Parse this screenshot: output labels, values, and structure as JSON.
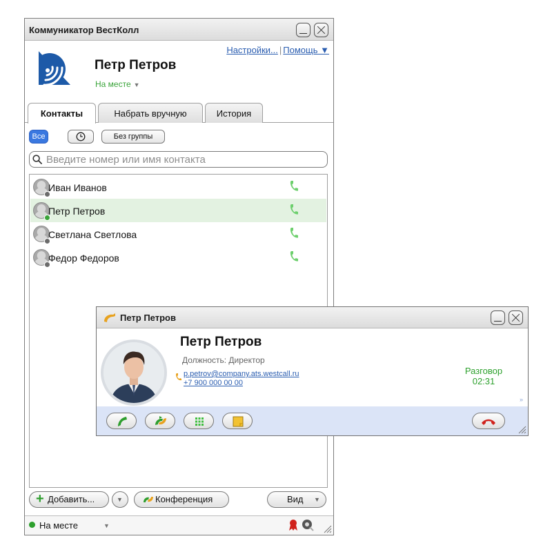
{
  "main_window": {
    "title": "Коммуникатор ВестКолл",
    "links": {
      "settings": "Настройки...",
      "separator": "|",
      "help": "Помощь ▼"
    },
    "user": {
      "name": "Петр Петров",
      "status": "На месте"
    },
    "tabs": [
      {
        "label": "Контакты",
        "active": true
      },
      {
        "label": "Набрать вручную",
        "active": false
      },
      {
        "label": "История",
        "active": false
      }
    ],
    "filters": {
      "all": "Все",
      "recent_icon": "clock-icon",
      "no_group": "Без группы"
    },
    "search": {
      "placeholder": "Введите номер или имя контакта",
      "value": ""
    },
    "contacts": [
      {
        "name": "Иван Иванов",
        "presence": "offline",
        "selected": false
      },
      {
        "name": "Петр Петров",
        "presence": "online",
        "selected": true
      },
      {
        "name": "Светлана Светлова",
        "presence": "offline",
        "selected": false
      },
      {
        "name": "Федор Федоров",
        "presence": "offline",
        "selected": false
      }
    ],
    "buttons": {
      "add": "Добавить...",
      "conference": "Конференция",
      "view": "Вид"
    },
    "statusbar": {
      "status": "На месте"
    }
  },
  "call_window": {
    "title": "Петр Петров",
    "name": "Петр Петров",
    "position": "Должность: Директор",
    "email": "p.petrov@company.ats.westcall.ru",
    "phone": "+7 900 000 00 00",
    "state": "Разговор",
    "duration": "02:31"
  },
  "colors": {
    "online": "#3aa43a",
    "offline": "#6b6b6b",
    "accent": "#3a78e0",
    "link": "#2a5db0",
    "selected_row": "#e3f2e1",
    "call_toolbar": "#dbe4f7",
    "hangup": "#d0221c"
  }
}
